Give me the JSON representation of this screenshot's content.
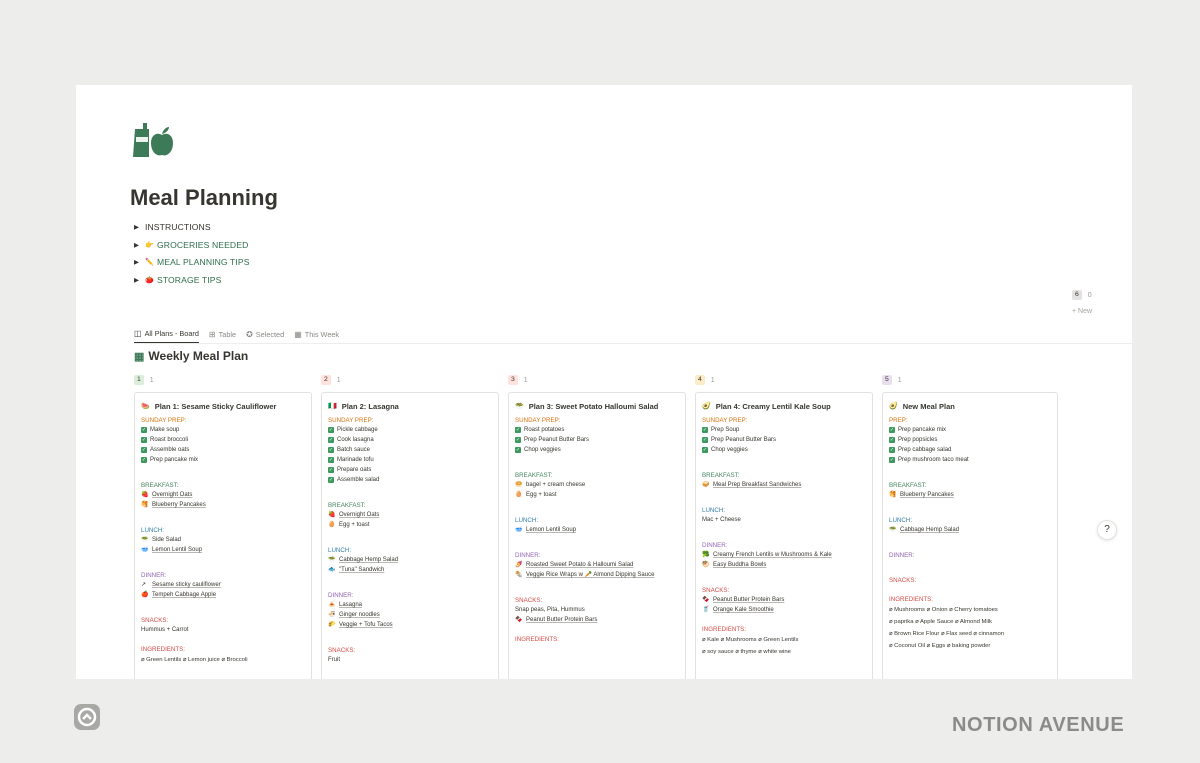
{
  "page": {
    "title": "Meal Planning"
  },
  "toggles": [
    {
      "label": "INSTRUCTIONS",
      "emoji": ""
    },
    {
      "label": "GROCERIES NEEDED",
      "emoji": "👉"
    },
    {
      "label": "MEAL PLANNING TIPS",
      "emoji": "✏️"
    },
    {
      "label": "STORAGE TIPS",
      "emoji": "🍅"
    }
  ],
  "tabs": [
    {
      "label": "All Plans - Board",
      "icon": "board-icon"
    },
    {
      "label": "Table",
      "icon": "table-icon"
    },
    {
      "label": "Selected",
      "icon": "check-badge-icon"
    },
    {
      "label": "This Week",
      "icon": "calendar-icon"
    }
  ],
  "database": {
    "title": "Weekly Meal Plan"
  },
  "columns": [
    {
      "num": "1",
      "count": "1",
      "color": "#dbeddb"
    },
    {
      "num": "2",
      "count": "1",
      "color": "#ffe2dd"
    },
    {
      "num": "3",
      "count": "1",
      "color": "#ffe2dd"
    },
    {
      "num": "4",
      "count": "1",
      "color": "#fdecc8"
    },
    {
      "num": "5",
      "count": "1",
      "color": "#e8deee"
    },
    {
      "num": "6",
      "count": "0",
      "color": "#e3e2e0"
    }
  ],
  "new_label": "+ New",
  "cards": [
    {
      "title": "Plan 1: Sesame Sticky Cauliflower",
      "emoji": "🍉",
      "prep_label": "SUNDAY PREP:",
      "prep": [
        "Make soup",
        "Roast broccoli",
        "Assemble oats",
        "Prep pancake mix"
      ],
      "breakfast_label": "BREAKFAST:",
      "breakfast": [
        {
          "e": "🍓",
          "t": "Overnight Oats"
        },
        {
          "e": "🥞",
          "t": "Blueberry Pancakes"
        }
      ],
      "lunch_label": "LUNCH:",
      "lunch": [
        {
          "e": "🥗",
          "t": "Side Salad",
          "plain": true
        },
        {
          "e": "🥣",
          "t": "Lemon Lentil Soup"
        }
      ],
      "dinner_label": "DINNER:",
      "dinner": [
        {
          "e": "↗",
          "t": "Sesame sticky cauliflower"
        },
        {
          "e": "🍎",
          "t": "Tempeh Cabbage Apple"
        }
      ],
      "snacks_label": "SNACKS:",
      "snacks": "Hummus + Carrot",
      "ingredients_label": "INGREDIENTS:",
      "ingredients": "⌀ Green Lentils ⌀ Lemon juice ⌀ Broccoli"
    },
    {
      "title": "Plan 2: Lasagna",
      "emoji": "🇮🇹",
      "prep_label": "SUNDAY PREP:",
      "prep": [
        "Pickle cabbage",
        "Cook lasagna",
        "Batch sauce",
        "Marinade tofu",
        "Prepare oats",
        "Assemble salad"
      ],
      "breakfast_label": "BREAKFAST:",
      "breakfast": [
        {
          "e": "🍓",
          "t": "Overnight Oats"
        },
        {
          "e": "🥚",
          "t": "Egg + toast",
          "plain": true
        }
      ],
      "lunch_label": "LUNCH:",
      "lunch": [
        {
          "e": "🥗",
          "t": "Cabbage Hemp Salad"
        },
        {
          "e": "🐟",
          "t": "\"Tuna\" Sandwich"
        }
      ],
      "dinner_label": "DINNER:",
      "dinner": [
        {
          "e": "🍝",
          "t": "Lasagna"
        },
        {
          "e": "🍜",
          "t": "Ginger noodles"
        },
        {
          "e": "🌮",
          "t": "Veggie + Tofu Tacos"
        }
      ],
      "snacks_label": "SNACKS:",
      "snacks": "Fruit"
    },
    {
      "title": "Plan 3: Sweet Potato Halloumi Salad",
      "emoji": "🥗",
      "prep_label": "SUNDAY PREP:",
      "prep": [
        "Roast potatoes",
        "Prep Peanut Butter Bars",
        "Chop veggies"
      ],
      "breakfast_label": "BREAKFAST:",
      "breakfast": [
        {
          "e": "🥯",
          "t": "bagel + cream cheese",
          "plain": true
        },
        {
          "e": "🥚",
          "t": "Egg + toast",
          "plain": true
        }
      ],
      "lunch_label": "LUNCH:",
      "lunch": [
        {
          "e": "🥣",
          "t": "Lemon Lentil Soup"
        }
      ],
      "dinner_label": "DINNER:",
      "dinner": [
        {
          "e": "🍠",
          "t": "Roasted Sweet Potato & Halloumi Salad"
        },
        {
          "e": "🌯",
          "t": "Veggie Rice Wraps w 🥕 Almond Dipping Sauce"
        }
      ],
      "snacks_label": "SNACKS:",
      "snacks": "Snap peas, Pita, Hummus",
      "snacks_link": {
        "e": "🍫",
        "t": "Peanut Butter Protein Bars"
      },
      "ingredients_label": "INGREDIENTS:"
    },
    {
      "title": "Plan 4: Creamy Lentil Kale Soup",
      "emoji": "🥑",
      "prep_label": "SUNDAY PREP:",
      "prep": [
        "Prep Soup",
        "Prep Peanut Butter Bars",
        "Chop veggies"
      ],
      "breakfast_label": "BREAKFAST:",
      "breakfast": [
        {
          "e": "🥪",
          "t": "Meal Prep Breakfast Sandwiches"
        }
      ],
      "lunch_label": "LUNCH:",
      "lunch_text": "Mac + Cheese",
      "dinner_label": "DINNER:",
      "dinner": [
        {
          "e": "🥦",
          "t": "Creamy French Lentils w Mushrooms & Kale"
        },
        {
          "e": "🥙",
          "t": "Easy Buddha Bowls"
        }
      ],
      "snacks_label": "SNACKS:",
      "snacks_items": [
        {
          "e": "🍫",
          "t": "Peanut Butter Protein Bars"
        },
        {
          "e": "🥤",
          "t": "Orange Kale Smoothie"
        }
      ],
      "ingredients_label": "INGREDIENTS:",
      "ingredients_lines": [
        "⌀ Kale ⌀ Mushrooms ⌀ Green Lentils",
        "⌀ soy sauce ⌀ thyme ⌀ white wine"
      ]
    },
    {
      "title": "New Meal Plan",
      "emoji": "🥑",
      "prep_label": "PREP:",
      "prep": [
        "Prep pancake mix",
        "Prep popsicles",
        "Prep cabbage salad",
        "Prep mushroom taco meat"
      ],
      "breakfast_label": "BREAKFAST:",
      "breakfast": [
        {
          "e": "🥞",
          "t": "Blueberry Pancakes"
        }
      ],
      "lunch_label": "LUNCH:",
      "lunch": [
        {
          "e": "🥗",
          "t": "Cabbage Hemp Salad"
        }
      ],
      "dinner_label": "DINNER:",
      "snacks_label": "SNACKS:",
      "ingredients_label": "INGREDIENTS:",
      "ingredients_lines": [
        "⌀ Mushrooms ⌀ Onion ⌀ Cherry tomatoes",
        "⌀ paprika ⌀ Apple Sauce ⌀ Almond Milk",
        "⌀ Brown Rice Flour ⌀ Flax seed ⌀ cinnamon",
        "⌀ Coconut Oil ⌀ Eggs ⌀ baking powder"
      ]
    }
  ],
  "help": "?",
  "brand": "NOTION AVENUE",
  "colors": {
    "accent_green": "#2f6f4f",
    "icon_green": "#3d7a57",
    "background": "#ededeb"
  }
}
